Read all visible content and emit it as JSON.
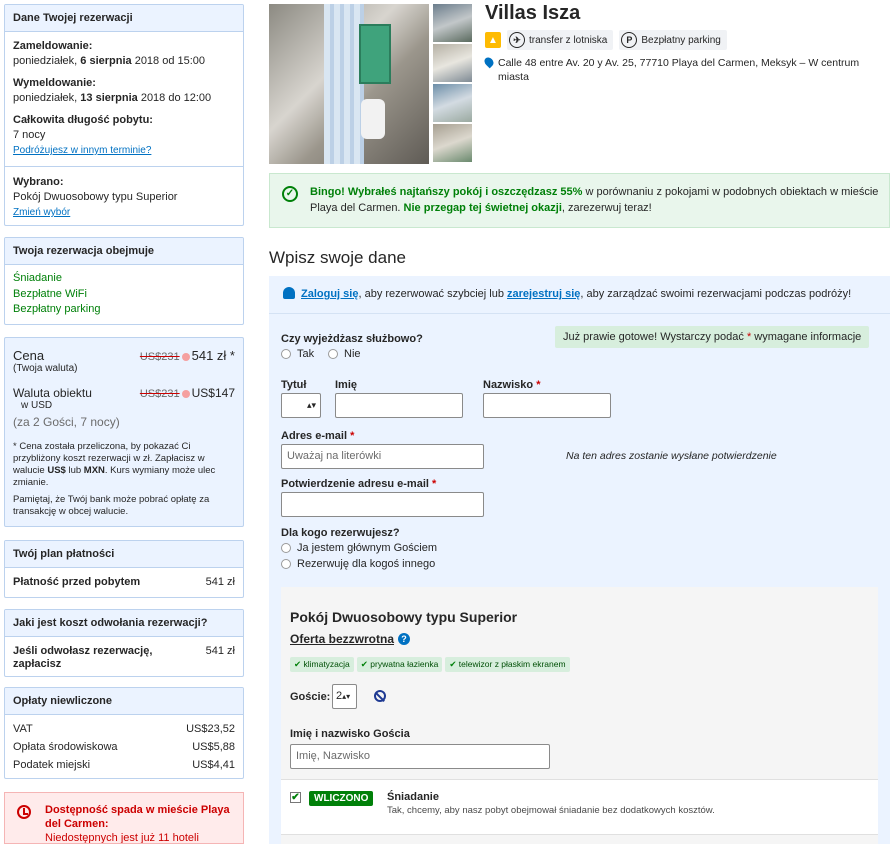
{
  "booking": {
    "header": "Dane Twojej rezerwacji",
    "checkin_label": "Zameldowanie:",
    "checkin_day": "poniedziałek, ",
    "checkin_date": "6 sierpnia",
    "checkin_rest": " 2018 od 15:00",
    "checkout_label": "Wymeldowanie:",
    "checkout_day": "poniedziałek, ",
    "checkout_date": "13 sierpnia",
    "checkout_rest": " 2018 do 12:00",
    "stay_label": "Całkowita długość pobytu:",
    "stay_value": "7 nocy",
    "change_dates": "Podróżujesz w innym terminie?",
    "chosen_label": "Wybrano:",
    "chosen_value": "Pokój Dwuosobowy typu Superior",
    "change_choice": "Zmień wybór"
  },
  "includes": {
    "header": "Twoja rezerwacja obejmuje",
    "items": [
      "Śniadanie",
      "Bezpłatne WiFi",
      "Bezpłatny parking"
    ]
  },
  "price": {
    "label": "Cena",
    "sublabel": "(Twoja waluta)",
    "old": "US$231",
    "value": "541 zł *",
    "currency_label": "Waluta obiektu",
    "currency_sub": "w USD",
    "old2": "US$231",
    "value2": "US$147",
    "guests": "(za 2 Gości, 7 nocy)",
    "note1_a": "* Cena została przeliczona, by pokazać Ci przybliżony koszt rezerwacji w zł. Zapłacisz w walucie ",
    "note1_b": "US$",
    "note1_c": " lub ",
    "note1_d": "MXN",
    "note1_e": ". Kurs wymiany może ulec zmianie.",
    "note2": "Pamiętaj, że Twój bank może pobrać opłatę za transakcję w obcej walucie."
  },
  "payment_plan": {
    "header": "Twój plan płatności",
    "label": "Płatność przed pobytem",
    "value": "541 zł"
  },
  "cancellation": {
    "header": "Jaki jest koszt odwołania rezerwacji?",
    "label": "Jeśli odwołasz rezerwację, zapłacisz",
    "value": "541 zł"
  },
  "fees": {
    "header": "Opłaty niewliczone",
    "rows": [
      {
        "label": "VAT",
        "value": "US$23,52"
      },
      {
        "label": "Opłata środowiskowa",
        "value": "US$5,88"
      },
      {
        "label": "Podatek miejski",
        "value": "US$4,41"
      }
    ]
  },
  "alert": {
    "title": "Dostępność spada w mieście Playa del Carmen:",
    "text": "Niedostępnych jest już 11 hoteli"
  },
  "hotel": {
    "name": "Villas Isza",
    "fac_transfer": "transfer z lotniska",
    "fac_parking": "Bezpłatny parking",
    "address": "Calle 48 entre Av. 20 y Av. 25, 77710 Playa del Carmen, Meksyk – W centrum miasta"
  },
  "bingo": {
    "a": "Bingo! ",
    "b": "Wybrałeś najtańszy pokój i oszczędzasz 55%",
    "c": " w porównaniu z pokojami w podobnych obiektach w mieście Playa del Carmen. ",
    "d": "Nie przegap tej świetnej okazji",
    "e": ", zarezerwuj teraz!"
  },
  "form": {
    "title": "Wpisz swoje dane",
    "login": "Zaloguj się",
    "login_mid": ", aby rezerwować szybciej lub ",
    "register": "zarejestruj się",
    "login_end": ", aby zarządzać swoimi rezerwacjami podczas podróży!",
    "business_q": "Czy wyjeżdżasz służbowo?",
    "yes": "Tak",
    "no": "Nie",
    "ready_a": "Już prawie gotowe! Wystarczy podać ",
    "ready_star": "*",
    "ready_b": " wymagane informacje",
    "title_label": "Tytuł",
    "first_label": "Imię",
    "last_label": "Nazwisko",
    "email_label": "Adres e-mail",
    "email_placeholder": "Uważaj na literówki",
    "email_note": "Na ten adres zostanie wysłane potwierdzenie",
    "confirm_label": "Potwierdzenie adresu e-mail",
    "for_whom": "Dla kogo rezerwujesz?",
    "main_guest": "Ja jestem głównym Gościem",
    "other": "Rezerwuję dla kogoś innego",
    "star": "*"
  },
  "room": {
    "title": "Pokój Dwuosobowy typu Superior",
    "offer": "Oferta bezzwrotna",
    "help": "?",
    "tags": [
      "klimatyzacja",
      "prywatna łazienka",
      "telewizor z płaskim ekranem"
    ],
    "guests_label": "Goście:",
    "guests_value": "2",
    "guest_name_label": "Imię i nazwisko Gościa",
    "guest_name_placeholder": "Imię, Nazwisko",
    "breakfast_badge": "WLICZONO",
    "breakfast_title": "Śniadanie",
    "breakfast_text": "Tak, chcemy, aby nasz pobyt obejmował śniadanie bez dodatkowych kosztów."
  }
}
